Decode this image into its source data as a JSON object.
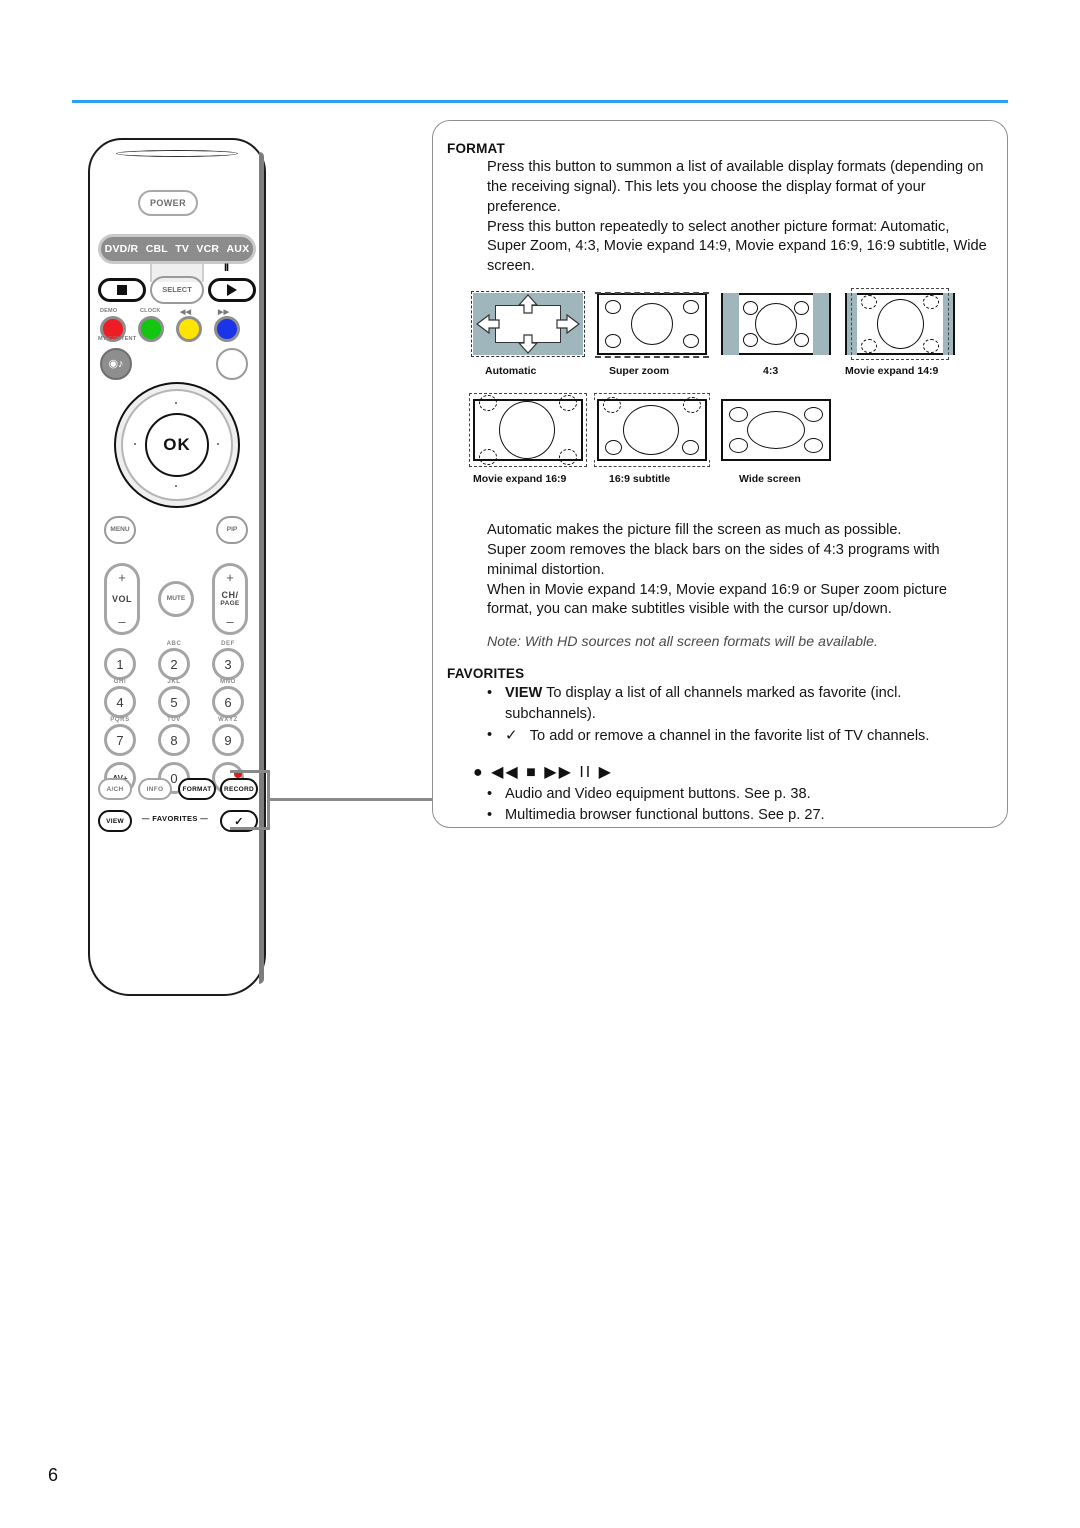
{
  "page": {
    "number": "6",
    "rule_color": "#2aa3f7"
  },
  "remote": {
    "power_label": "POWER",
    "device_modes": [
      "DVD/R",
      "CBL",
      "TV",
      "VCR",
      "AUX"
    ],
    "select_label": "SELECT",
    "pause_glyph": "II",
    "stop_glyph": "■",
    "play_glyph": "▶",
    "color_buttons": [
      {
        "label": "DEMO",
        "color": "#ee1c25"
      },
      {
        "label": "CLOCK",
        "color": "#13c60f"
      },
      {
        "label": "◀◀",
        "color": "#ffe400"
      },
      {
        "label": "▶▶",
        "color": "#1a34e8"
      }
    ],
    "my_content_label": "MY CONTENT",
    "ok_label": "OK",
    "menu_label": "MENU",
    "pip_label": "PIP",
    "vol_label": "VOL",
    "mute_label": "MUTE",
    "ch_label": "CH/",
    "ch_sub_label": "PAGE",
    "plus_glyph": "+",
    "minus_glyph": "–",
    "keypad": [
      {
        "digit": "1",
        "letters": ""
      },
      {
        "digit": "2",
        "letters": "ABC"
      },
      {
        "digit": "3",
        "letters": "DEF"
      },
      {
        "digit": "4",
        "letters": "GHI"
      },
      {
        "digit": "5",
        "letters": "JKL"
      },
      {
        "digit": "6",
        "letters": "MNO"
      },
      {
        "digit": "7",
        "letters": "PQRS"
      },
      {
        "digit": "8",
        "letters": "TUV"
      },
      {
        "digit": "9",
        "letters": "WXYZ"
      },
      {
        "digit": "AV+",
        "letters": ""
      },
      {
        "digit": "0",
        "letters": ""
      },
      {
        "digit": "-",
        "letters": ""
      }
    ],
    "function_buttons": [
      "A/CH",
      "INFO",
      "FORMAT",
      "RECORD"
    ],
    "view_label": "VIEW",
    "favorites_label": "—  FAVORITES  —",
    "check_label": "✓",
    "record_led_color": "#e01b1b"
  },
  "panel": {
    "format": {
      "heading": "FORMAT",
      "paragraph_1": "Press this button to summon a list of available display formats (depending on the receiving signal). This lets you choose the display format of your preference.",
      "paragraph_2": "Press this button repeatedly to select another picture format: Automatic, Super Zoom, 4:3, Movie expand 14:9, Movie expand 16:9, 16:9 subtitle, Wide screen.",
      "diagram_captions_row1": [
        "Automatic",
        "Super zoom",
        "4:3",
        "Movie expand 14:9"
      ],
      "diagram_captions_row2": [
        "Movie expand 16:9",
        "16:9 subtitle",
        "Wide screen"
      ],
      "paragraph_3": "Automatic makes the picture fill the screen as much as possible.",
      "paragraph_4": "Super zoom removes the black bars on the sides of 4:3 programs with minimal distortion.",
      "paragraph_5": "When in Movie expand 14:9, Movie expand 16:9 or Super zoom picture format, you can make subtitles visible with the cursor up/down.",
      "note": "Note: With HD sources not all screen formats will be available."
    },
    "favorites": {
      "heading": "FAVORITES",
      "item_1_keyword": "VIEW",
      "item_1_text": "To display a list of all channels marked as favorite (incl. subchannels).",
      "item_2_keyword": "✓",
      "item_2_text": "To add or remove a channel in the favorite list of TV channels."
    },
    "transport": {
      "glyphs": "● ◀◀ ■ ▶▶ II ▶",
      "item_1": "Audio and Video equipment buttons. See p. 38.",
      "item_2": "Multimedia browser functional buttons. See p. 27."
    }
  },
  "colors": {
    "screen_bar": "#9fb6bd",
    "outline": "#111111"
  }
}
